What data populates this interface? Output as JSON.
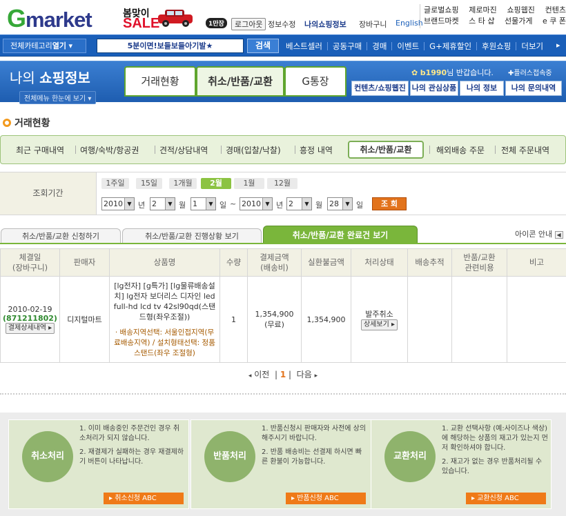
{
  "header": {
    "logo_g": "G",
    "logo_rest": "market",
    "promo_line1": "봄맞이",
    "promo_line2": "SALE",
    "promo_badge": "1만장",
    "logout": "로그아웃",
    "edit_info": "정보수정",
    "my_shopping": "나의쇼핑정보",
    "cart": "장바구니",
    "english": "English",
    "util_row1": [
      "글로벌쇼핑",
      "제로마진",
      "쇼핑웹진",
      "컨텐츠"
    ],
    "util_row2": [
      "브랜드마켓",
      "스 타 샵",
      "선물가게",
      "e 쿠 폰"
    ]
  },
  "nav": {
    "category_label": "전체카테고리",
    "category_open": "열기",
    "search_text": "5분이면!보들보들아기발★",
    "search_button": "검색",
    "menu": [
      "베스트셀러",
      "공동구매",
      "경매",
      "이벤트",
      "G+제휴할인",
      "후원쇼핑",
      "더보기"
    ]
  },
  "my_header": {
    "title_prefix": "나의",
    "title_main": "쇼핑정보",
    "sub_button": "전체메뉴 한눈에 보기",
    "tabs": [
      "거래현황",
      "취소/반품/교환",
      "G통장"
    ],
    "user_id": "b1990",
    "welcome_suffix": "님 반갑습니다.",
    "plus_login": "플러스접속중",
    "buttons": [
      "컨텐츠/쇼핑웹진",
      "나의 관심상품",
      "나의 정보",
      "나의 문의내역"
    ]
  },
  "section_title": "거래현황",
  "sub_tabs": [
    "최근 구매내역",
    "여행/숙박/항공권",
    "견적/상담내역",
    "경매(입찰/낙찰)",
    "흥정 내역",
    "취소/반품/교환",
    "해외배송 주문",
    "전체 주문내역"
  ],
  "filter": {
    "label": "조회기간",
    "periods": [
      "1주일",
      "15일",
      "1개월",
      "2월",
      "1월",
      "12월"
    ],
    "active_period": "2월",
    "from": {
      "year": "2010",
      "month": "2",
      "day": "1"
    },
    "to": {
      "year": "2010",
      "month": "2",
      "day": "28"
    },
    "unit_year": "년",
    "unit_month": "월",
    "unit_day": "일",
    "tilde": "~",
    "lookup_button": "조 회"
  },
  "status_tabs": [
    "취소/반품/교환 신청하기",
    "취소/반품/교환 진행상황 보기",
    "취소/반품/교환 완료건 보기"
  ],
  "icon_guide": "아이콘 안내",
  "table": {
    "headers": [
      [
        "체결일",
        "(장바구니)"
      ],
      [
        "판매자",
        ""
      ],
      [
        "상품명",
        ""
      ],
      [
        "수량",
        ""
      ],
      [
        "결제금액",
        "(배송비)"
      ],
      [
        "실환불금액",
        ""
      ],
      [
        "처리상태",
        ""
      ],
      [
        "배송추적",
        ""
      ],
      [
        "반품/교환",
        "관련비용"
      ],
      [
        "비고",
        ""
      ]
    ],
    "row": {
      "date": "2010-02-19",
      "order_no": "(871211802)",
      "detail_button": "결제상세내역",
      "seller": "디지털마트",
      "product": "[lg전자] [g특가] [lg물류배송설치] lg전자 보더리스 디자인 led full-hd lcd tv 42sl90qd(스탠드형(좌우조절))",
      "option": "· 배송지역선택: 서울인접지역(무료배송지역) / 설치형태선택: 정품스탠드(좌우 조절형)",
      "qty": "1",
      "pay_amount": "1,354,900",
      "shipping": "(무료)",
      "refund": "1,354,900",
      "status": "발주취소",
      "status_button": "상세보기"
    }
  },
  "pager": {
    "prev": "이전",
    "current": "1",
    "next": "다음"
  },
  "info_boxes": [
    {
      "title": "취소처리",
      "p1": "1. 이미 배송중인 주문건인 경우 취소처리가 되지 않습니다.",
      "p2": "2. 재결제가 실패하는 경우 재결제하기 버튼이 나타납니다.",
      "button": "취소신청 ABC"
    },
    {
      "title": "반품처리",
      "p1": "1. 반품신청시 판매자와 사전에 상의해주시기 바랍니다.",
      "p2": "2. 반품 배송비는 선결제 하시면 빠른 환불이 가능합니다.",
      "button": "반품신청 ABC"
    },
    {
      "title": "교환처리",
      "p1": "1. 교환 선택사항 (예:사이즈나 색상)에 해당하는 상품의 재고가 있는지 먼저 확인하셔야 합니다.",
      "p2": "2. 재고가 없는 경우 반품처리될 수 있습니다.",
      "button": "교환신청 ABC"
    }
  ],
  "colors": {
    "brand_blue": "#1a5fb9",
    "green": "#7ab63b",
    "orange": "#e2731c"
  }
}
